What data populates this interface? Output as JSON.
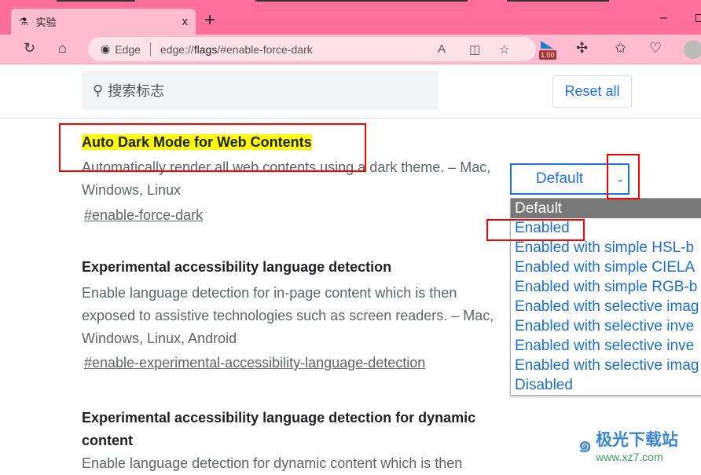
{
  "browser": {
    "tab_title": "实验",
    "tab_icon": "flask-icon",
    "new_tab": "+",
    "close": "x",
    "address_brand": "Edge",
    "url_prefix": "edge://",
    "url_bold": "flags",
    "url_suffix": "/#enable-force-dark",
    "extension_badge": "1.00",
    "accent": "#ff6f9c"
  },
  "search": {
    "placeholder": "搜索标志"
  },
  "reset_label": "Reset all",
  "flags": [
    {
      "title": "Auto Dark Mode for Web Contents",
      "desc": "Automatically render all web contents using a dark theme. – Mac, Windows, Linux",
      "link": "#enable-force-dark"
    },
    {
      "title": "Experimental accessibility language detection",
      "desc": "Enable language detection for in-page content which is then exposed to assistive technologies such as screen readers. – Mac, Windows, Linux, Android",
      "link": "#enable-experimental-accessibility-language-detection"
    },
    {
      "title": "Experimental accessibility language detection for dynamic content",
      "desc": "Enable language detection for dynamic content which is then"
    }
  ],
  "select": {
    "value": "Default",
    "options": [
      "Default",
      "Enabled",
      "Enabled with simple HSL-b",
      "Enabled with simple CIELA",
      "Enabled with simple RGB-b",
      "Enabled with selective imag",
      "Enabled with selective inve",
      "Enabled with selective inve",
      "Enabled with selective imag",
      "Disabled"
    ]
  },
  "watermark": {
    "name": "极光下载站",
    "url": "www.xz7.com"
  }
}
